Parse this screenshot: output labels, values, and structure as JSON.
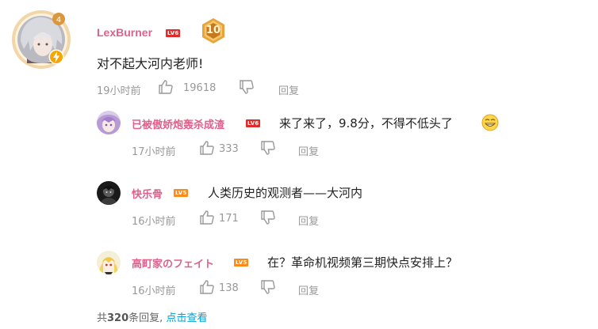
{
  "main_comment": {
    "username": "LexBurner",
    "level": "LV6",
    "medal": "10",
    "content": "对不起大河内老师!",
    "time": "19小时前",
    "likes": "19618",
    "reply_label": "回复"
  },
  "replies": [
    {
      "username": "已被傲娇炮轰杀成渣",
      "level": "LV6",
      "content": "来了来了，9.8分，不得不低头了",
      "time": "17小时前",
      "likes": "333",
      "reply_label": "回复"
    },
    {
      "username": "快乐骨",
      "level": "LV5",
      "content": "人类历史的观测者——大河内",
      "time": "16小时前",
      "likes": "171",
      "reply_label": "回复"
    },
    {
      "username": "高町家のフェイト",
      "level": "LV5",
      "content": "在？革命机视频第三期快点安排上？",
      "time": "16小时前",
      "likes": "138",
      "reply_label": "回复"
    }
  ],
  "footer": {
    "prefix": "共",
    "count": "320",
    "suffix": "条回复,",
    "link": "点击查看"
  },
  "colors": {
    "username": "#e0608a",
    "level_red": "#e02b2b",
    "level_orange": "#ff8a1a",
    "link": "#00a1d6",
    "meta": "#999999"
  }
}
